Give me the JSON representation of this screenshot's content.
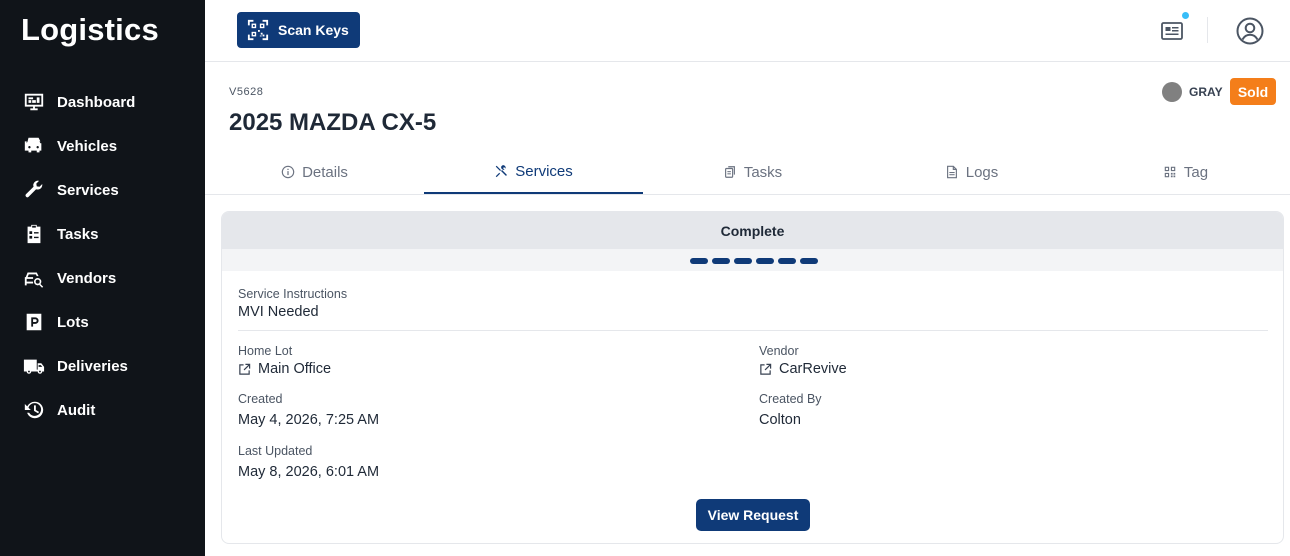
{
  "app": {
    "title": "Logistics"
  },
  "sidebar": {
    "items": [
      {
        "label": "Dashboard",
        "icon": "dashboard-icon"
      },
      {
        "label": "Vehicles",
        "icon": "vehicles-icon"
      },
      {
        "label": "Services",
        "icon": "wrench-icon"
      },
      {
        "label": "Tasks",
        "icon": "clipboard-icon"
      },
      {
        "label": "Vendors",
        "icon": "vendor-car-search-icon"
      },
      {
        "label": "Lots",
        "icon": "parking-icon"
      },
      {
        "label": "Deliveries",
        "icon": "truck-icon"
      },
      {
        "label": "Audit",
        "icon": "history-icon"
      }
    ]
  },
  "header": {
    "scan_label": "Scan Keys",
    "scan_icon": "qr-code-icon",
    "news_icon": "newspaper-icon",
    "avatar_icon": "user-circle-icon",
    "notification_color": "#38bdf8"
  },
  "vehicle": {
    "id": "V5628",
    "title": "2025 MAZDA CX-5",
    "color_label": "GRAY",
    "color_hex": "#808080",
    "status": "Sold",
    "status_color": "#f47e1a"
  },
  "tabs": [
    {
      "label": "Details",
      "icon": "info-icon",
      "active": false
    },
    {
      "label": "Services",
      "icon": "tools-icon",
      "active": true
    },
    {
      "label": "Tasks",
      "icon": "clipboard-copy-icon",
      "active": false
    },
    {
      "label": "Logs",
      "icon": "document-icon",
      "active": false
    },
    {
      "label": "Tag",
      "icon": "qr-tag-icon",
      "active": false
    }
  ],
  "service": {
    "status": "Complete",
    "progress_steps_complete": 6,
    "progress_steps_total": 6,
    "instructions_label": "Service Instructions",
    "instructions_value": "MVI Needed",
    "home_lot_label": "Home Lot",
    "home_lot_value": "Main Office",
    "vendor_label": "Vendor",
    "vendor_value": "CarRevive",
    "created_label": "Created",
    "created_value": "May 4, 2026, 7:25 AM",
    "created_by_label": "Created By",
    "created_by_value": "Colton",
    "updated_label": "Last Updated",
    "updated_value": "May 8, 2026, 6:01 AM",
    "view_button_label": "View Request"
  },
  "colors": {
    "primary": "#0f3a78",
    "sidebar_bg": "#101419"
  }
}
